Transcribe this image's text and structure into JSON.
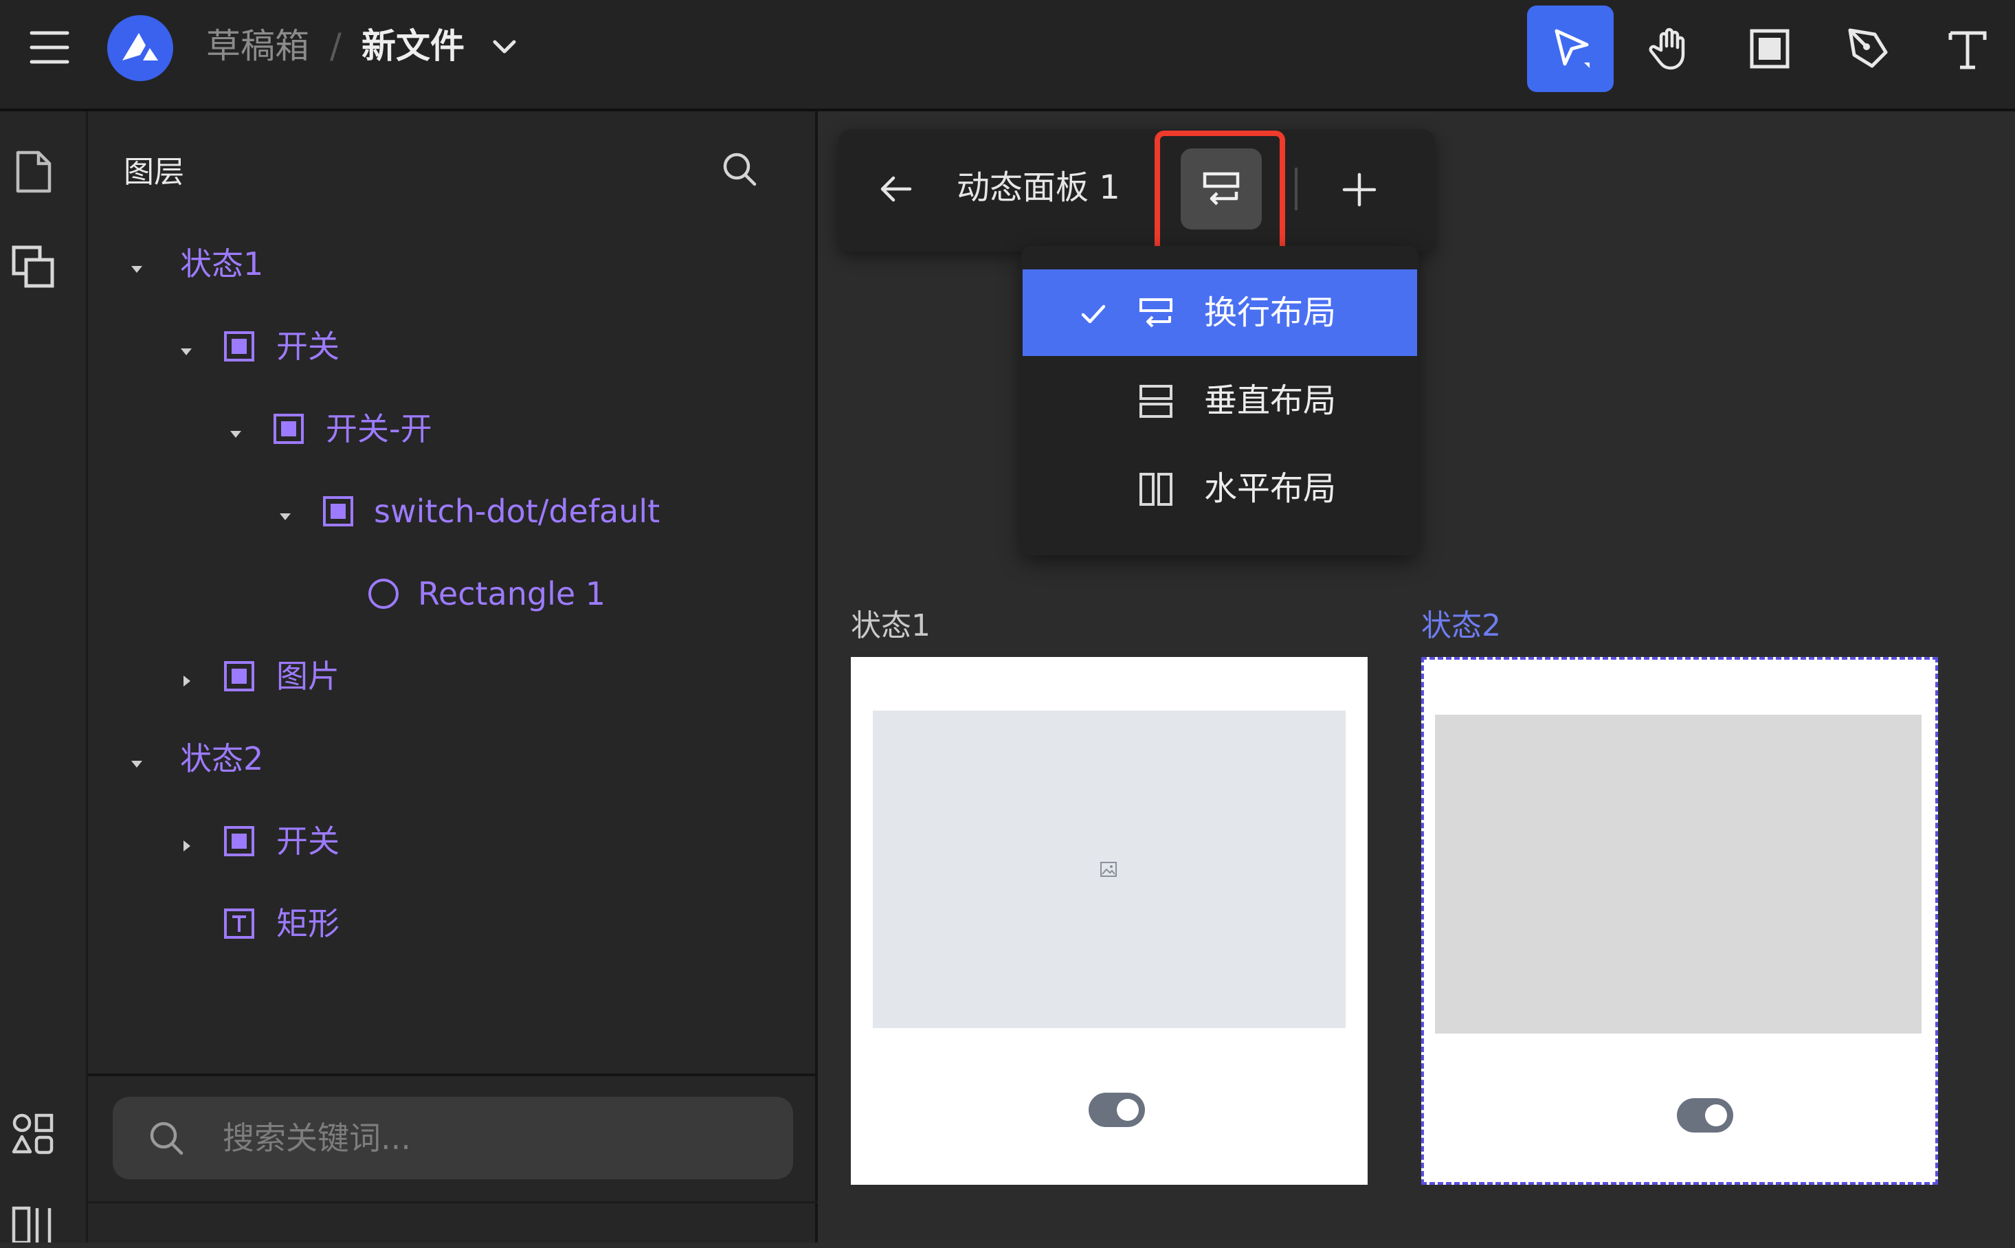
{
  "header": {
    "breadcrumb_parent": "草稿箱",
    "breadcrumb_separator": "/",
    "file_name": "新文件",
    "icons": [
      "menu-icon",
      "app-logo-icon",
      "chevron-down-icon"
    ],
    "tools": [
      {
        "name": "select-tool",
        "icon": "pointer-arrow-icon",
        "active": true
      },
      {
        "name": "hand-tool",
        "icon": "hand-icon",
        "active": false
      },
      {
        "name": "frame-tool",
        "icon": "frame-icon",
        "active": false
      },
      {
        "name": "pen-tool",
        "icon": "pen-icon",
        "active": false
      },
      {
        "name": "text-tool",
        "icon": "text-icon",
        "active": false
      }
    ]
  },
  "rail": {
    "icons": [
      "page-icon",
      "layers-icon",
      "components-icon",
      "layout-icon"
    ]
  },
  "layers": {
    "title": "图层",
    "items": [
      {
        "label": "状态1",
        "kind": "group",
        "expanded": true
      },
      {
        "label": "开关",
        "kind": "frame",
        "expanded": true
      },
      {
        "label": "开关-开",
        "kind": "frame",
        "expanded": true
      },
      {
        "label": "switch-dot/default",
        "kind": "frame",
        "expanded": true
      },
      {
        "label": "Rectangle 1",
        "kind": "ellipse"
      },
      {
        "label": "图片",
        "kind": "frame",
        "expanded": false
      },
      {
        "label": "状态2",
        "kind": "group",
        "expanded": true
      },
      {
        "label": "开关",
        "kind": "frame",
        "expanded": false
      },
      {
        "label": "矩形",
        "kind": "text"
      }
    ],
    "search_placeholder": "搜索关键词..."
  },
  "canvas": {
    "panel_title": "动态面板 1",
    "layout_menu": {
      "items": [
        {
          "label": "换行布局",
          "icon": "wrap-layout-icon",
          "selected": true
        },
        {
          "label": "垂直布局",
          "icon": "vertical-layout-icon",
          "selected": false
        },
        {
          "label": "水平布局",
          "icon": "horizontal-layout-icon",
          "selected": false
        }
      ]
    },
    "states": [
      {
        "label": "状态1",
        "toggle_on": true
      },
      {
        "label": "状态2",
        "toggle_on": true
      }
    ]
  },
  "colors": {
    "accent": "#3f6bf0",
    "layer_text": "#9d7bff",
    "highlight": "#ee3b2b",
    "state2_label": "#6f7cf0"
  }
}
